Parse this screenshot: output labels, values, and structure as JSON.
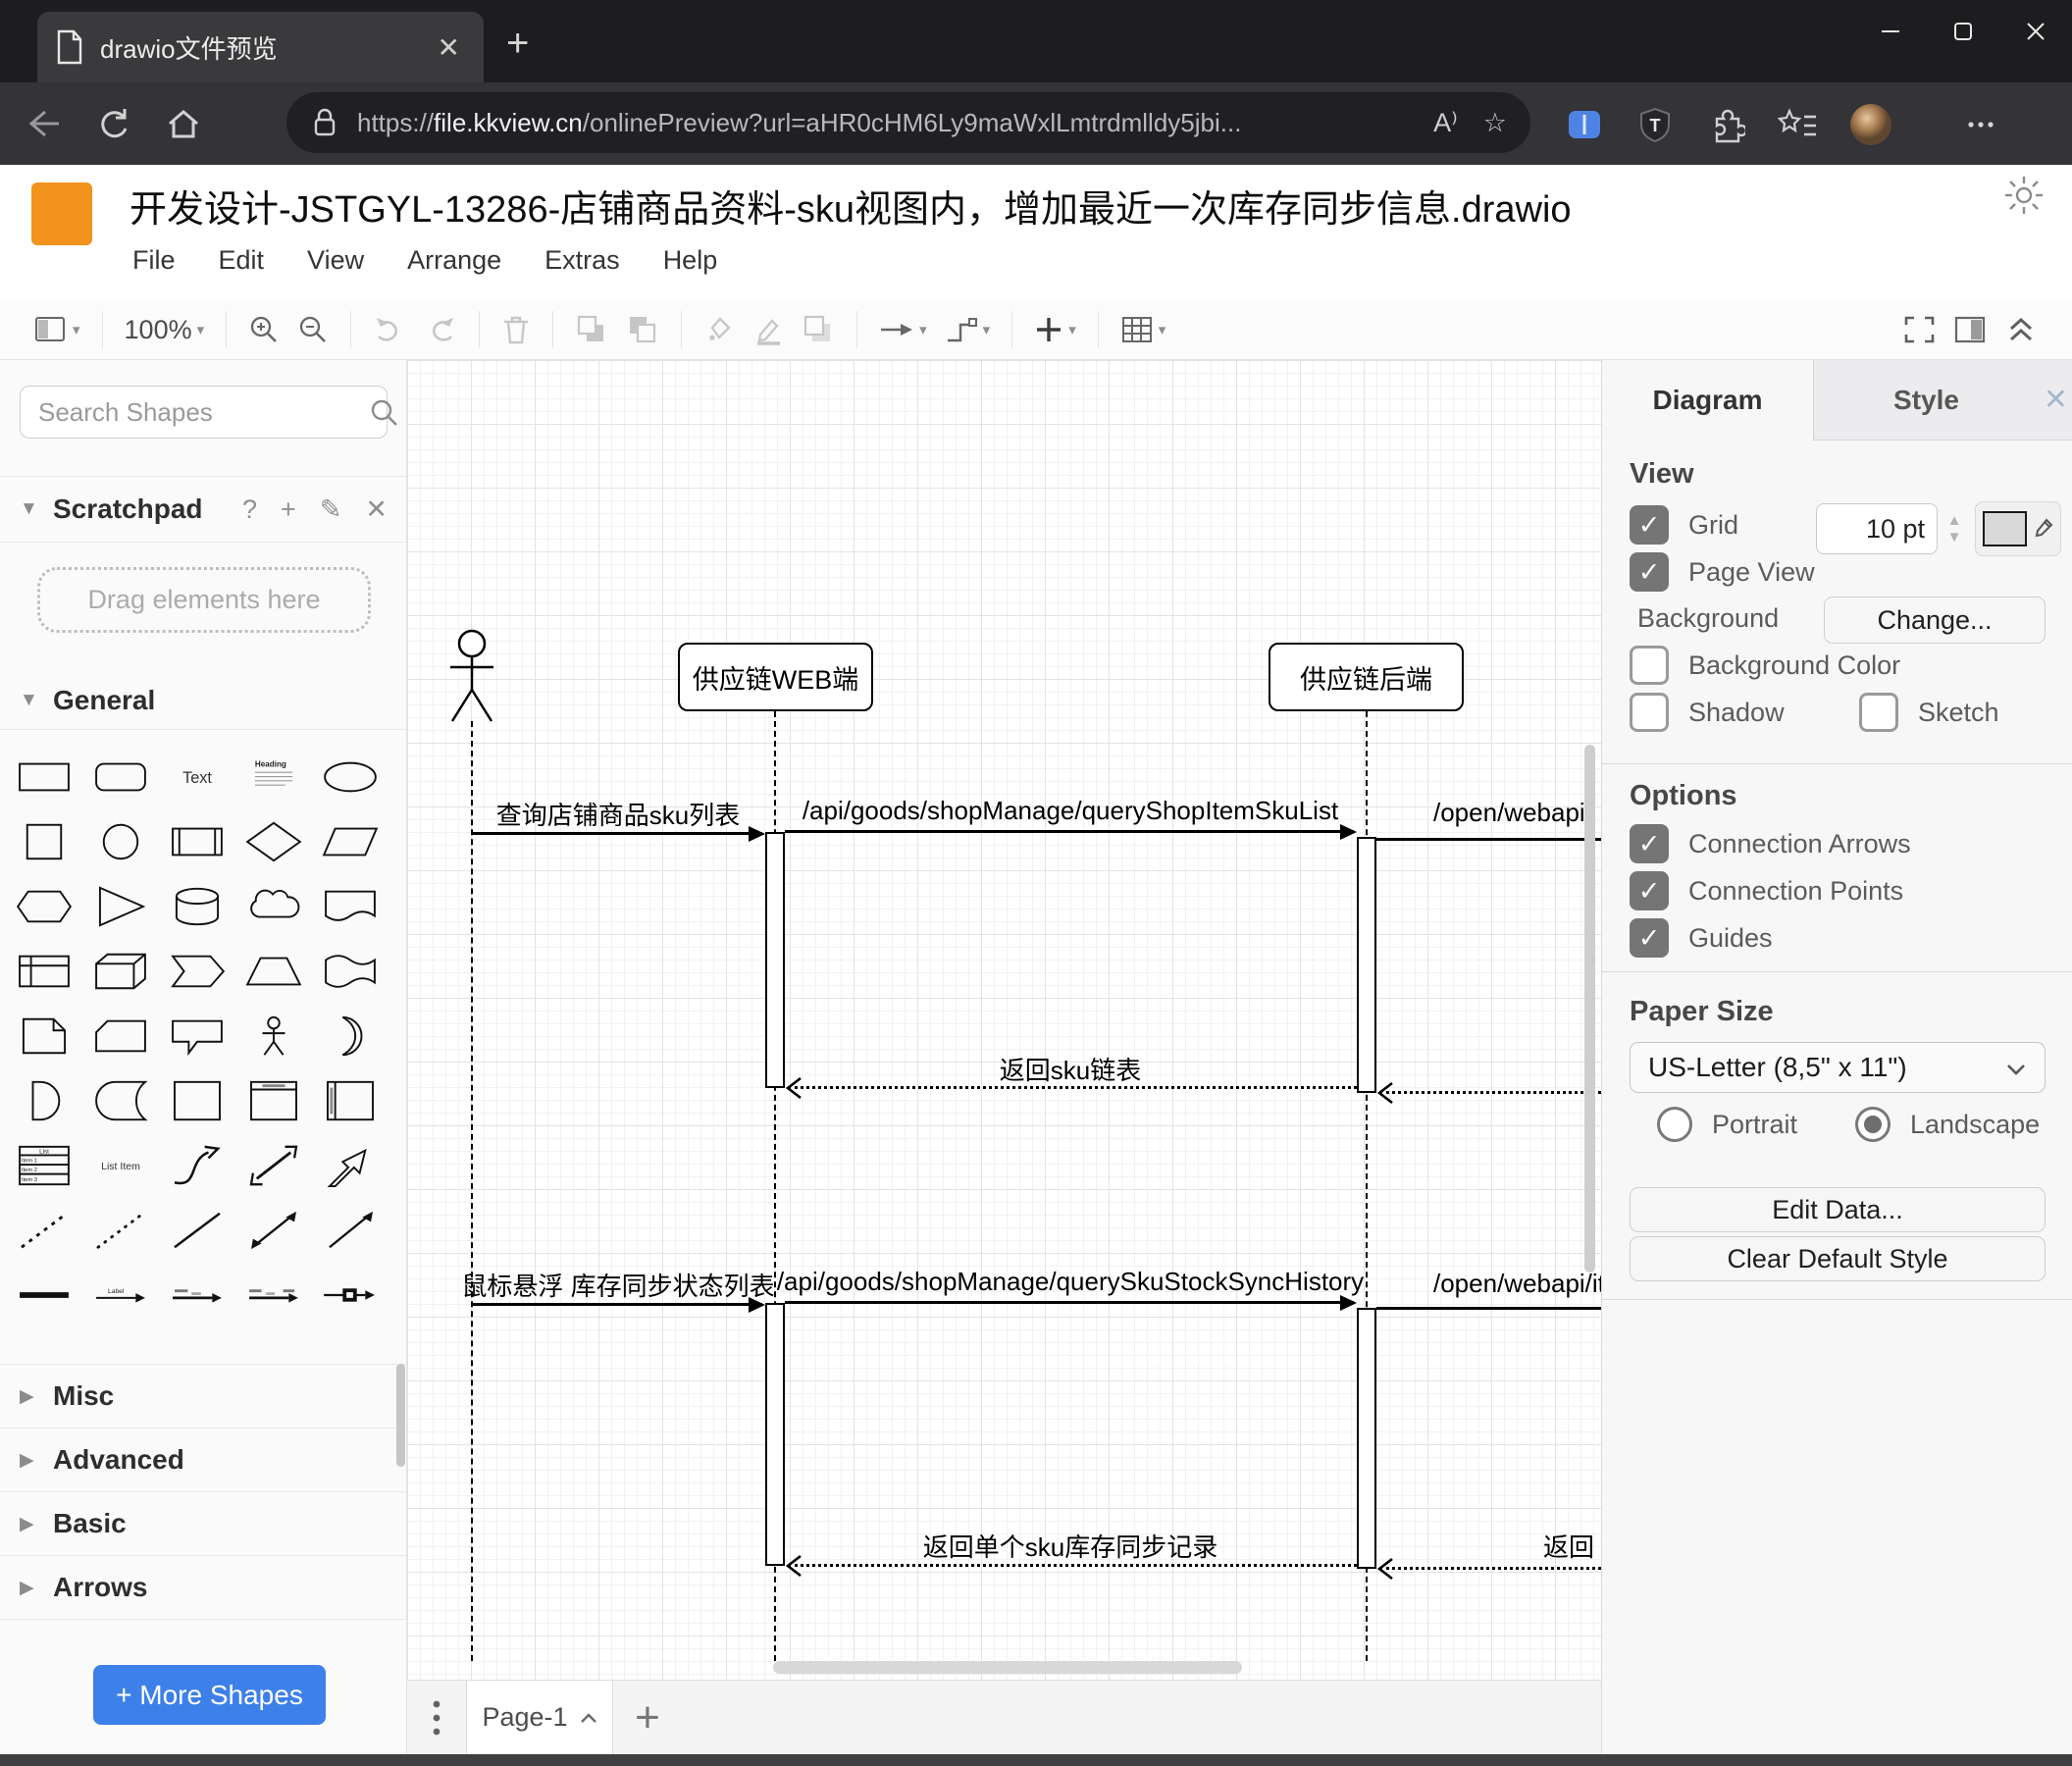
{
  "browser": {
    "tab_title": "drawio文件预览",
    "url_prefix": "https://",
    "url_domain": "file.kkview.cn",
    "url_path": "/onlinePreview?url=aHR0cHM6Ly9maWxlLmtrdmlldy5jbi...",
    "read_aloud": "A"
  },
  "app": {
    "title": "开发设计-JSTGYL-13286-店铺商品资料-sku视图内，增加最近一次库存同步信息.drawio",
    "menus": [
      "File",
      "Edit",
      "View",
      "Arrange",
      "Extras",
      "Help"
    ],
    "zoom_level": "100%"
  },
  "sidebar": {
    "search_placeholder": "Search Shapes",
    "scratchpad_label": "Scratchpad",
    "scratchpad_hint": "Drag elements here",
    "sections": {
      "general": "General",
      "misc": "Misc",
      "advanced": "Advanced",
      "basic": "Basic",
      "arrows": "Arrows"
    },
    "shape_labels": {
      "text": "Text",
      "heading": "Heading",
      "list_title": "List",
      "item1": "Item 1",
      "item2": "Item 2",
      "item3": "Item 3",
      "list_item": "List Item",
      "label": "Label"
    },
    "more_shapes": "+ More Shapes"
  },
  "diagram": {
    "lifeline_web": "供应链WEB端",
    "lifeline_backend": "供应链后端",
    "m1": "查询店铺商品sku列表",
    "m2": "/api/goods/shopManage/queryShopItemSkuList",
    "m3": "/open/webapi/",
    "r1": "返回sku链表",
    "m4": "鼠标悬浮 库存同步状态列表",
    "m5": "/api/goods/shopManage/querySkuStockSyncHistory",
    "m6": "/open/webapi/item",
    "r2": "返回单个sku库存同步记录",
    "r3": "返回"
  },
  "panel": {
    "tab_diagram": "Diagram",
    "tab_style": "Style",
    "view_heading": "View",
    "grid_label": "Grid",
    "grid_size": "10 pt",
    "page_view": "Page View",
    "background": "Background",
    "change_btn": "Change...",
    "background_color": "Background Color",
    "shadow": "Shadow",
    "sketch": "Sketch",
    "options_heading": "Options",
    "connection_arrows": "Connection Arrows",
    "connection_points": "Connection Points",
    "guides": "Guides",
    "paper_heading": "Paper Size",
    "paper_size": "US-Letter (8,5\" x 11\")",
    "portrait": "Portrait",
    "landscape": "Landscape",
    "edit_data": "Edit Data...",
    "clear_style": "Clear Default Style"
  },
  "footer": {
    "page_tab": "Page-1"
  }
}
